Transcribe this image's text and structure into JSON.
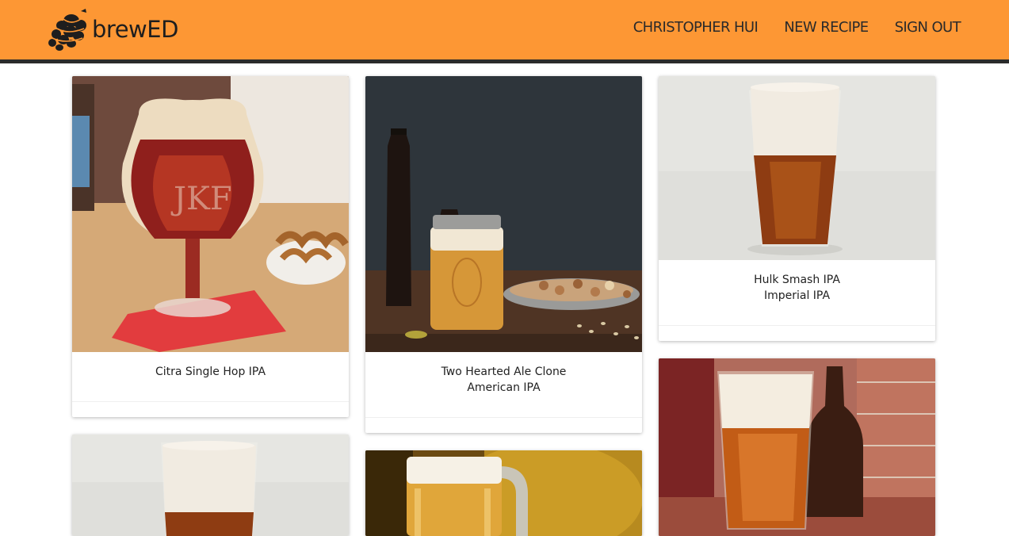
{
  "header": {
    "brand": "brewED",
    "nav": [
      "CHRISTOPHER HUI",
      "NEW RECIPE",
      "SIGN OUT"
    ]
  },
  "colors": {
    "header": "#fd9734",
    "header_border": "#2b2b2b"
  },
  "recipes": [
    {
      "name": "Citra Single Hop IPA",
      "style": ""
    },
    {
      "name": "Two Hearted Ale Clone",
      "style": "American IPA"
    },
    {
      "name": "Hulk Smash IPA",
      "style": "Imperial IPA"
    },
    {
      "name": "",
      "style": ""
    },
    {
      "name": "",
      "style": ""
    },
    {
      "name": "",
      "style": ""
    }
  ]
}
